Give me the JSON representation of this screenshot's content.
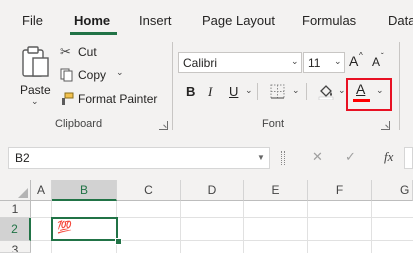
{
  "tabs": [
    {
      "label": "File"
    },
    {
      "label": "Home"
    },
    {
      "label": "Insert"
    },
    {
      "label": "Page Layout"
    },
    {
      "label": "Formulas"
    },
    {
      "label": "Data"
    }
  ],
  "clipboard": {
    "paste_label": "Paste",
    "cut_label": "Cut",
    "copy_label": "Copy",
    "format_painter_label": "Format Painter",
    "group_label": "Clipboard"
  },
  "font": {
    "font_name": "Calibri",
    "font_size": "11",
    "bold_glyph": "B",
    "italic_glyph": "I",
    "underline_glyph": "U",
    "increase_glyph": "A",
    "decrease_glyph": "A",
    "font_color_glyph": "A",
    "group_label": "Font",
    "font_color_bar": "#ff0000"
  },
  "highlight": {
    "color": "#e81123"
  },
  "formula_bar": {
    "name_box": "B2",
    "cancel_glyph": "✕",
    "enter_glyph": "✓",
    "fx_glyph": "fx"
  },
  "sheet": {
    "columns": [
      "A",
      "B",
      "C",
      "D",
      "E",
      "F",
      "G"
    ],
    "rows": [
      "1",
      "2",
      "3"
    ],
    "b2_value": "💯"
  }
}
